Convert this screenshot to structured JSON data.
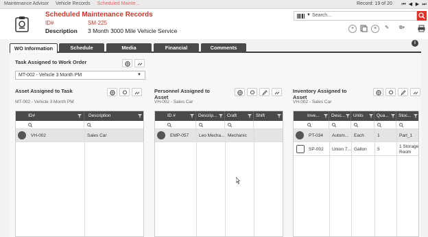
{
  "breadcrumbs": [
    "Maintenance Advisor",
    "Vehicle Records",
    "Scheduled Mainte..."
  ],
  "record_text": "Record: 19 of 20",
  "header": {
    "title": "Scheduled Maintenance Records",
    "id_label": "ID#",
    "id_value": "SM-225",
    "desc_label": "Description",
    "desc_value": "3 Month 3000 Mile Vehicle Service"
  },
  "search": {
    "placeholder": "Search..."
  },
  "tabs": [
    {
      "label": "WO Information",
      "active": true
    },
    {
      "label": "Schedule"
    },
    {
      "label": "Media"
    },
    {
      "label": "Financial"
    },
    {
      "label": "Comments"
    }
  ],
  "task": {
    "title": "Task Assigned to Work Order",
    "selected": "MT-002 - Vehicle 3 Month PM"
  },
  "asset_section": {
    "title": "Asset Assigned to Task",
    "subtitle": "MT-002 - Vehicle 3 Month PM",
    "columns": [
      "ID#",
      "Description"
    ],
    "rows": [
      {
        "id": "VH-002",
        "description": "Sales Car"
      }
    ]
  },
  "personnel_section": {
    "title": "Personnel Assigned to Asset",
    "subtitle": "VH-002 - Sales Car",
    "columns": [
      "ID #",
      "Descrip...",
      "Craft",
      "Shift"
    ],
    "rows": [
      {
        "id": "EMP-057",
        "description": "Leo Mecha...",
        "craft": "Mechanic",
        "shift": ""
      }
    ]
  },
  "inventory_section": {
    "title": "Inventory Assigned to Asset",
    "subtitle": "VH-002 - Sales Car",
    "columns": [
      "Inve...",
      "Desc...",
      "Units",
      "Qua...",
      "Stoc..."
    ],
    "rows": [
      {
        "id": "PT-034",
        "description": "Autom...",
        "units": "Each",
        "qty": "1",
        "stock": "Part_1"
      },
      {
        "id": "SP-002",
        "description": "Union 7...",
        "units": "Gallon",
        "qty": "5",
        "stock": "1 Storage Room"
      }
    ]
  },
  "colors": {
    "accent": "#c0392b",
    "tab_bg": "#4a4a4a",
    "grid_header": "#4a4a4a"
  }
}
